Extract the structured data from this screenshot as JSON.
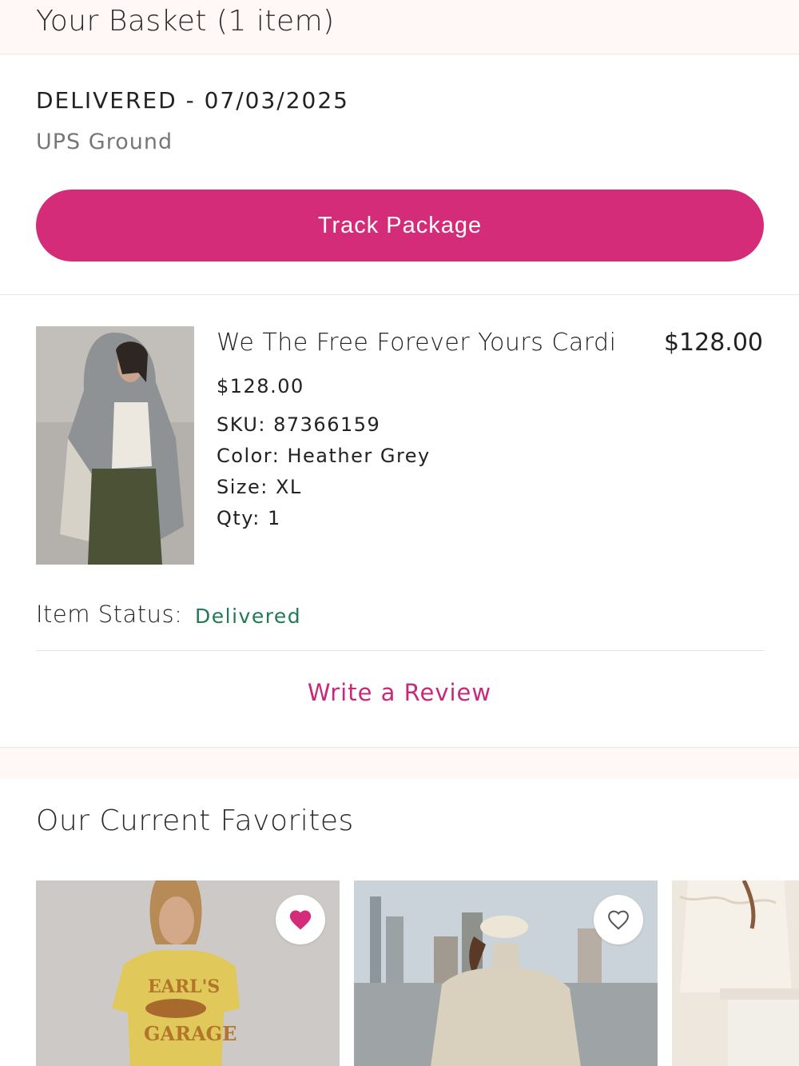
{
  "header": {
    "title": "Your Basket (1 item)"
  },
  "delivery": {
    "status": "DELIVERED - 07/03/2025",
    "carrier": "UPS Ground",
    "track_label": "Track Package"
  },
  "item": {
    "name": "We The Free Forever Yours Cardi",
    "total": "$128.00",
    "price": "$128.00",
    "sku": "SKU: 87366159",
    "color": "Color: Heather Grey",
    "size": "Size: XL",
    "qty": "Qty: 1",
    "status_label": "Item Status:",
    "status_value": "Delivered",
    "review_label": "Write a Review"
  },
  "favorites": {
    "title": "Our Current Favorites",
    "cards": [
      {
        "image": "yellow-graphic-tee-photo",
        "favorited": true
      },
      {
        "image": "cream-jacket-cap-photo",
        "favorited": false
      },
      {
        "image": "white-ruffle-blouse-photo",
        "favorited": false
      }
    ]
  },
  "colors": {
    "accent": "#d42c79",
    "review_link": "#c62a7a",
    "delivered_green": "#1f7a55",
    "header_bg": "#fff8f6"
  }
}
